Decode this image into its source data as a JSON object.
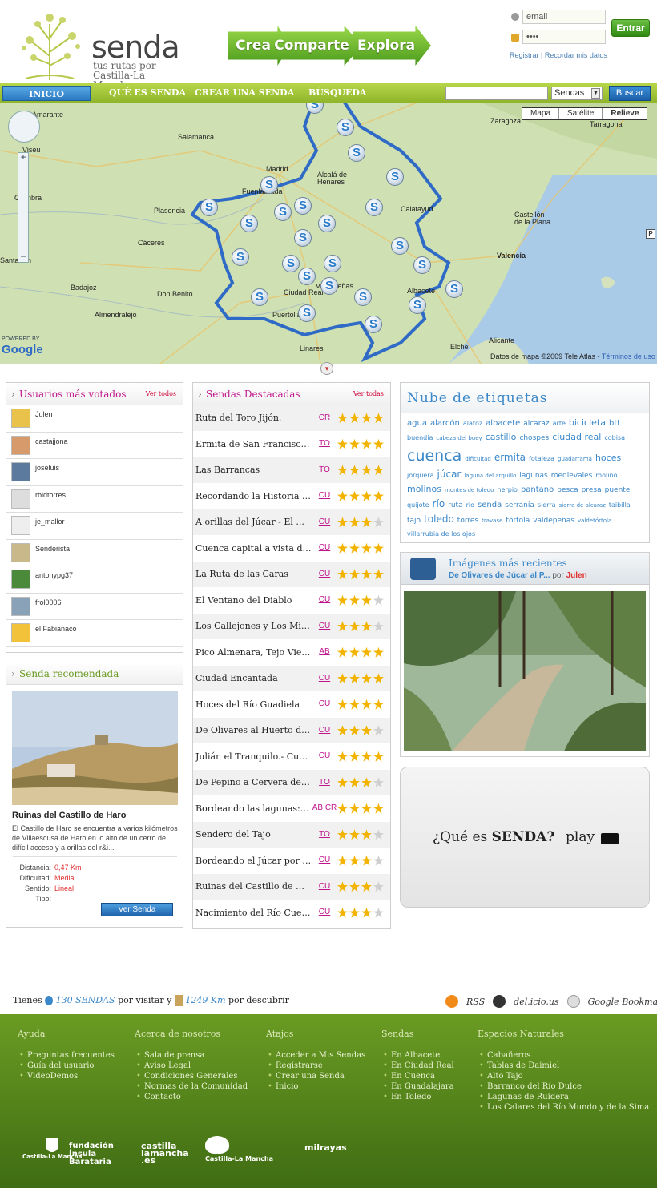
{
  "header": {
    "brand": "senda",
    "tagline": "tus rutas por Castilla-La Mancha",
    "arrows": [
      "Crea",
      "Comparte",
      "Explora"
    ],
    "login": {
      "email_value": "email",
      "password_value": "••••",
      "submit": "Entrar",
      "register": "Registrar",
      "separator": "|",
      "remember": "Recordar mis datos"
    }
  },
  "nav": {
    "items": [
      "INICIO",
      "QUÉ ES SENDA",
      "CREAR UNA SENDA",
      "BÚSQUEDA"
    ],
    "search_value": "",
    "select_value": "Sendas",
    "search_button": "Buscar"
  },
  "map": {
    "tabs": [
      "Mapa",
      "Satélite",
      "Relieve"
    ],
    "cities": [
      "Calatayud",
      "Amarante",
      "Salamanca",
      "Zaragoza",
      "Tarragona",
      "Viseu",
      "Madrid",
      "Alcalá de Henares",
      "Coimbra",
      "Fuenlabrada",
      "Plasencia",
      "Castellón de la Plana",
      "Cáceres",
      "Valencia",
      "Santarém",
      "Badajoz",
      "Ciudad Real",
      "Albacete",
      "Don Benito",
      "Valdepeñas",
      "Almendralejo",
      "Puertollano",
      "Alicante",
      "Linares",
      "Elche"
    ],
    "copyright": "Datos de mapa ©2009 Tele Atlas -",
    "terms": "Términos de uso",
    "powered": "POWERED BY",
    "google": "Google"
  },
  "usuarios": {
    "title": "Usuarios más votados",
    "ver_todos": "Ver todos",
    "items": [
      "Julen",
      "castajjona",
      "joseluis",
      "rbldtorres",
      "je_mallor",
      "Senderista",
      "antonypg37",
      "frol0006",
      "el Fabianaco"
    ]
  },
  "recomendada": {
    "title": "Senda recomendada",
    "name": "Ruinas del Castillo de Haro",
    "desc": "El Castillo de Haro se encuentra a varios kilómetros de Villaescusa de Haro en lo alto de un cerro de difícil acceso y a orillas del r&i...",
    "labels": [
      "Distancia:",
      "Dificultad:",
      "Sentido:",
      "Tipo:"
    ],
    "values": [
      "0,47 Km",
      "Media",
      "Lineal",
      ""
    ],
    "button": "Ver Senda"
  },
  "destacadas": {
    "title": "Sendas Destacadas",
    "ver_todas": "Ver todas",
    "rows": [
      {
        "name": "Ruta del Toro Jijón.",
        "prov": "CR",
        "rating": 4
      },
      {
        "name": "Ermita de San Francisco a...",
        "prov": "TO",
        "rating": 4
      },
      {
        "name": "Las Barrancas",
        "prov": "TO",
        "rating": 4
      },
      {
        "name": "Recordando la Historia de...",
        "prov": "CU",
        "rating": 4
      },
      {
        "name": "A orillas del Júcar - El ...",
        "prov": "CU",
        "rating": 3
      },
      {
        "name": "Cuenca capital a vista de...",
        "prov": "CU",
        "rating": 4
      },
      {
        "name": "La Ruta de las Caras",
        "prov": "CU",
        "rating": 4
      },
      {
        "name": "El Ventano del Diablo",
        "prov": "CU",
        "rating": 3
      },
      {
        "name": "Los Callejones y Los Mira...",
        "prov": "CU",
        "rating": 3
      },
      {
        "name": "Pico Almenara, Tejo Viejo...",
        "prov": "AB",
        "rating": 4
      },
      {
        "name": "Ciudad Encantada",
        "prov": "CU",
        "rating": 4
      },
      {
        "name": "Hoces del Río Guadiela",
        "prov": "CU",
        "rating": 4
      },
      {
        "name": "De Olivares al Huerto de ...",
        "prov": "CU",
        "rating": 3
      },
      {
        "name": "Julián el Tranquilo.- Cue...",
        "prov": "CU",
        "rating": 4
      },
      {
        "name": "De Pepino a Cervera de lo...",
        "prov": "TO",
        "rating": 3
      },
      {
        "name": "Bordeando las lagunas: de...",
        "prov": "AB CR",
        "rating": 4
      },
      {
        "name": "Sendero del Tajo",
        "prov": "TO",
        "rating": 3
      },
      {
        "name": "Bordeando el Júcar por Al...",
        "prov": "CU",
        "rating": 3
      },
      {
        "name": "Ruinas del Castillo de Ha...",
        "prov": "CU",
        "rating": 3
      },
      {
        "name": "Nacimiento del Río Cuervo",
        "prov": "CU",
        "rating": 3
      }
    ]
  },
  "nube": {
    "title": "Nube de etiquetas",
    "tags": [
      {
        "t": "agua",
        "s": 10
      },
      {
        "t": "alarcón",
        "s": 10
      },
      {
        "t": "alatoz",
        "s": 8
      },
      {
        "t": "albacete",
        "s": 10
      },
      {
        "t": "alcaraz",
        "s": 9
      },
      {
        "t": "arte",
        "s": 8
      },
      {
        "t": "bicicleta",
        "s": 11
      },
      {
        "t": "btt",
        "s": 10
      },
      {
        "t": "buendía",
        "s": 8
      },
      {
        "t": "cabeza del buey",
        "s": 7
      },
      {
        "t": "castillo",
        "s": 11
      },
      {
        "t": "chospes",
        "s": 9
      },
      {
        "t": "ciudad real",
        "s": 11
      },
      {
        "t": "cobisa",
        "s": 8
      },
      {
        "t": "cuenca",
        "s": 19
      },
      {
        "t": "dificultad",
        "s": 7
      },
      {
        "t": "ermita",
        "s": 12
      },
      {
        "t": "fotaleza",
        "s": 8
      },
      {
        "t": "guadarrama",
        "s": 7
      },
      {
        "t": "hoces",
        "s": 11
      },
      {
        "t": "jorquera",
        "s": 8
      },
      {
        "t": "júcar",
        "s": 12
      },
      {
        "t": "laguna del arquillo",
        "s": 7
      },
      {
        "t": "lagunas",
        "s": 9
      },
      {
        "t": "medievales",
        "s": 9
      },
      {
        "t": "molino",
        "s": 8
      },
      {
        "t": "molinos",
        "s": 11
      },
      {
        "t": "montes de toledo",
        "s": 7
      },
      {
        "t": "nerpio",
        "s": 8
      },
      {
        "t": "pantano",
        "s": 10
      },
      {
        "t": "pesca",
        "s": 9
      },
      {
        "t": "presa",
        "s": 9
      },
      {
        "t": "puente",
        "s": 9
      },
      {
        "t": "quijote",
        "s": 8
      },
      {
        "t": "río",
        "s": 12
      },
      {
        "t": "ruta",
        "s": 9
      },
      {
        "t": "rio",
        "s": 8
      },
      {
        "t": "senda",
        "s": 10
      },
      {
        "t": "serranía",
        "s": 9
      },
      {
        "t": "sierra",
        "s": 8
      },
      {
        "t": "sierra de alcaraz",
        "s": 7
      },
      {
        "t": "taibilla",
        "s": 8
      },
      {
        "t": "tajo",
        "s": 9
      },
      {
        "t": "toledo",
        "s": 12
      },
      {
        "t": "torres",
        "s": 9
      },
      {
        "t": "travase",
        "s": 7
      },
      {
        "t": "tórtola",
        "s": 9
      },
      {
        "t": "valdepeñas",
        "s": 9
      },
      {
        "t": "valdetórtola",
        "s": 7
      },
      {
        "t": "villarrubia de los ojos",
        "s": 8
      }
    ]
  },
  "imagenes": {
    "title": "Imágenes más recientes",
    "caption": "De Olivares de Júcar al P...",
    "por": "por",
    "author": "Julen"
  },
  "video": {
    "question": "¿Qué es",
    "brand": "SENDA?",
    "play": "play"
  },
  "stats": {
    "prefix": "Tienes",
    "sendas": "130 SENDAS",
    "mid": "por visitar y",
    "km": "1249 Km",
    "suffix": "por descubrir"
  },
  "social": [
    "RSS",
    "del.icio.us",
    "Google Bookmarks"
  ],
  "footer": {
    "cols": [
      {
        "h": "Ayuda",
        "links": [
          "Preguntas frecuentes",
          "Guía del usuario",
          "VideoDemos"
        ]
      },
      {
        "h": "Acerca de nosotros",
        "links": [
          "Sala de prensa",
          "Aviso Legal",
          "Condiciones Generales",
          "Normas de la Comunidad",
          "Contacto"
        ]
      },
      {
        "h": "Atajos",
        "links": [
          "Acceder a Mis Sendas",
          "Registrarse",
          "Crear una Senda",
          "Inicio"
        ]
      },
      {
        "h": "Sendas",
        "links": [
          "En Albacete",
          "En Ciudad Real",
          "En Cuenca",
          "En Guadalajara",
          "En Toledo"
        ]
      },
      {
        "h": "Espacios Naturales",
        "links": [
          "Cabañeros",
          "Tablas de Daimiel",
          "Alto Tajo",
          "Barranco del Río Dulce",
          "Lagunas de Ruidera",
          "Los Calares del Río Mundo y de la Sima"
        ]
      }
    ],
    "logos": [
      "Castilla-La Mancha",
      "fundación Ínsula Barataria",
      "castilla lamancha .es",
      "Castilla-La Mancha",
      "milrayas"
    ]
  },
  "colors": {
    "green": "#8fb52a",
    "blue": "#2a78c0",
    "magenta": "#c0148c",
    "tag_blue": "#3a87c9"
  }
}
